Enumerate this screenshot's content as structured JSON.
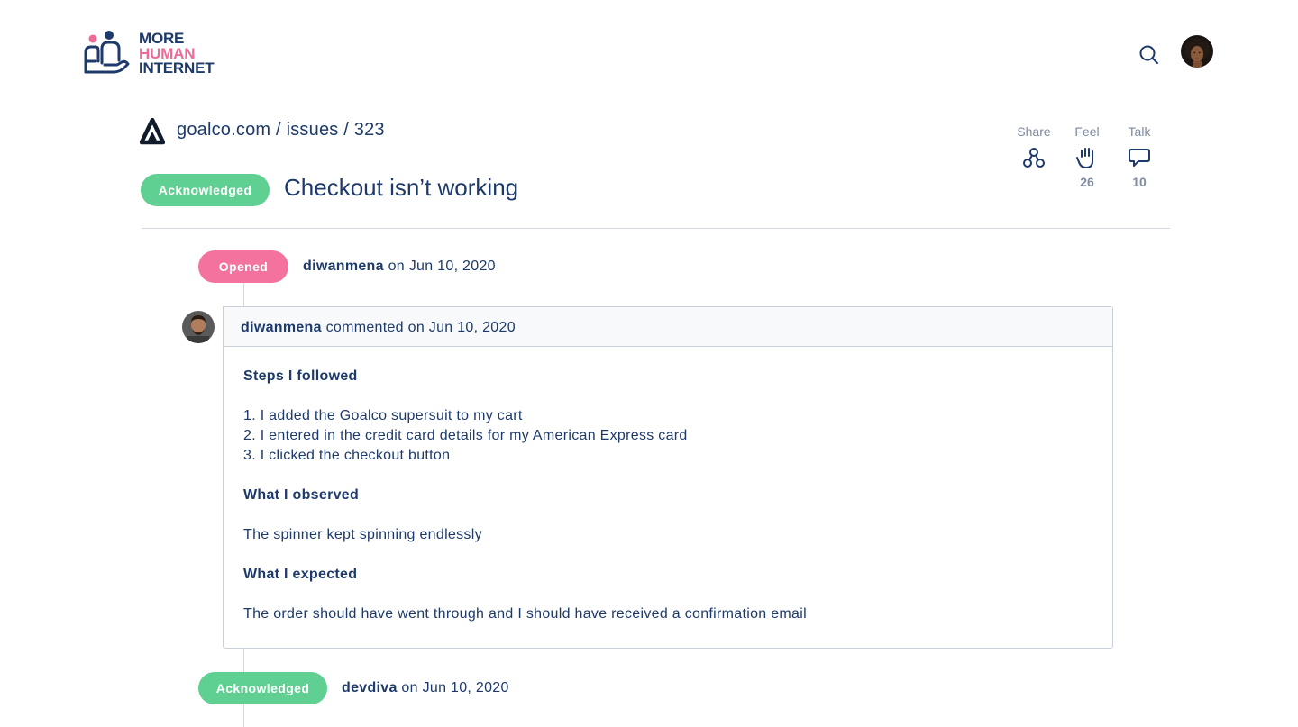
{
  "brand": {
    "line1": "MORE",
    "line2": "HUMAN",
    "line3": "INTERNET",
    "accent_color": "#f06a98",
    "primary_color": "#1d3a6b"
  },
  "header": {
    "search_icon": "search-icon"
  },
  "issue": {
    "site": "goalco.com",
    "sep1": "/",
    "section": "issues",
    "sep2": "/",
    "number": "323",
    "status": "Acknowledged",
    "title": "Checkout isn’t working"
  },
  "actions": {
    "share": {
      "label": "Share",
      "icon": "share-nodes-icon"
    },
    "feel": {
      "label": "Feel",
      "icon": "hand-icon",
      "count": "26"
    },
    "talk": {
      "label": "Talk",
      "icon": "speech-bubble-icon",
      "count": "10"
    }
  },
  "timeline": {
    "event1": {
      "badge": "Opened",
      "user": "diwanmena",
      "text": " on Jun 10, 2020",
      "color": "#f4739e"
    },
    "comment": {
      "user": "diwanmena",
      "meta": " commented on Jun 10, 2020",
      "steps_heading": "Steps I followed",
      "steps": [
        "1. I added the Goalco supersuit to my cart",
        "2. I entered in the credit card details for my American Express card",
        "3. I clicked the checkout button"
      ],
      "observed_heading": "What I observed",
      "observed": "The spinner kept spinning endlessly",
      "expected_heading": "What I expected",
      "expected": "The order should have went through and I should have received a confirmation email"
    },
    "event2": {
      "badge": "Acknowledged",
      "user": "devdiva",
      "text": " on Jun 10, 2020",
      "color": "#5fcf92"
    }
  }
}
